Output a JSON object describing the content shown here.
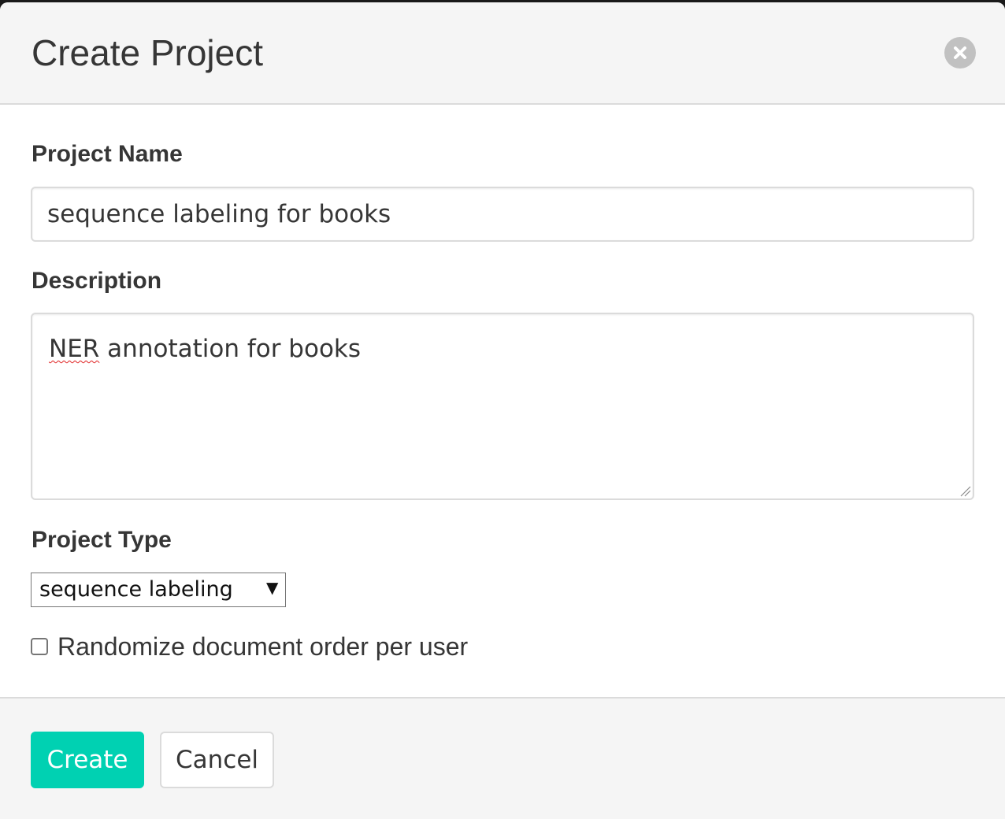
{
  "modal": {
    "title": "Create Project"
  },
  "form": {
    "project_name": {
      "label": "Project Name",
      "value": "sequence labeling for books"
    },
    "description": {
      "label": "Description",
      "misspelled_word": "NER",
      "rest_text": " annotation for books"
    },
    "project_type": {
      "label": "Project Type",
      "selected": "sequence labeling",
      "arrow": "▼"
    },
    "randomize": {
      "label": "Randomize document order per user",
      "checked": false
    }
  },
  "footer": {
    "create_label": "Create",
    "cancel_label": "Cancel"
  },
  "colors": {
    "primary": "#00d1b2",
    "header_bg": "#f5f5f5",
    "close_bg": "#c1c1c1"
  },
  "icons": {
    "close": "close-icon",
    "resize": "resize-handle-icon"
  }
}
